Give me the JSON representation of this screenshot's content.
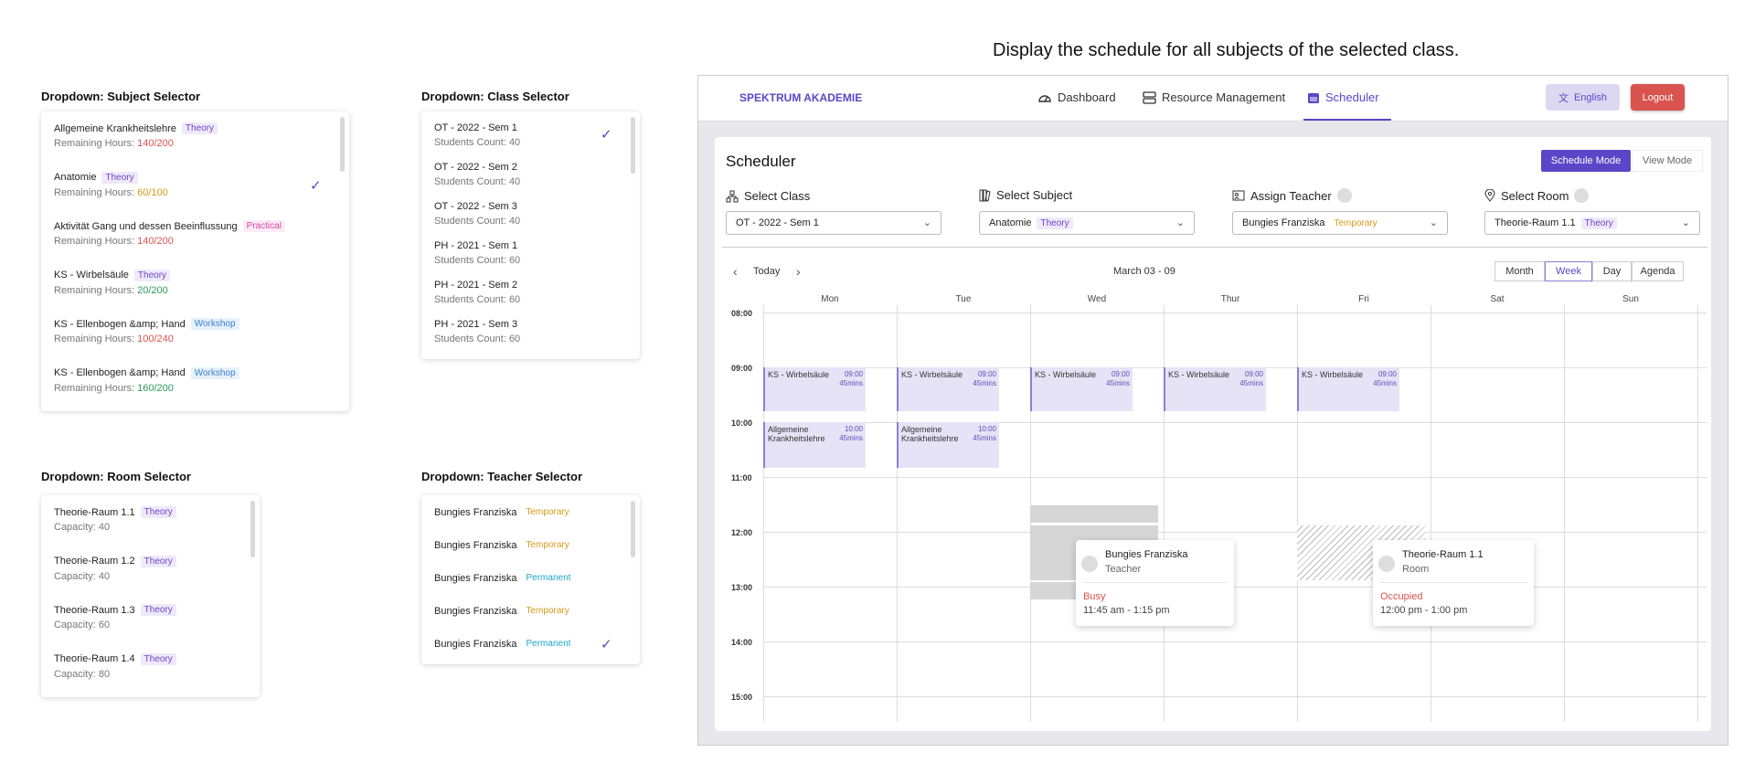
{
  "heading": "Display the schedule for all subjects of the selected class.",
  "subject_dropdown": {
    "title": "Dropdown: Subject Selector",
    "items": [
      {
        "name": "Allgemeine Krankheitslehre",
        "tag": "Theory",
        "prefix": "Remaining Hours: ",
        "hours": "140/200",
        "hours_color": "red"
      },
      {
        "name": "Anatomie",
        "tag": "Theory",
        "prefix": "Remaining Hours: ",
        "hours": "60/100",
        "hours_color": "orange"
      },
      {
        "name": "Aktivität Gang und dessen Beeinflussung",
        "tag": "Practical",
        "prefix": "Remaining Hours: ",
        "hours": "140/200",
        "hours_color": "red"
      },
      {
        "name": "KS - Wirbelsäule",
        "tag": "Theory",
        "prefix": "Remaining Hours: ",
        "hours": "20/200",
        "hours_color": "green"
      },
      {
        "name": "KS - Ellenbogen &amp; Hand",
        "tag": "Workshop",
        "prefix": "Remaining Hours: ",
        "hours": "100/240",
        "hours_color": "red"
      },
      {
        "name": "KS - Ellenbogen &amp; Hand",
        "tag": "Workshop",
        "prefix": "Remaining Hours: ",
        "hours": "160/200",
        "hours_color": "green"
      }
    ]
  },
  "class_dropdown": {
    "title": "Dropdown: Class Selector",
    "items": [
      {
        "name": "OT - 2022 - Sem 1",
        "sub": "Students Count: 40"
      },
      {
        "name": "OT - 2022 - Sem 2",
        "sub": "Students Count: 40"
      },
      {
        "name": "OT - 2022 - Sem 3",
        "sub": "Students Count: 40"
      },
      {
        "name": "PH - 2021 - Sem 1",
        "sub": "Students Count: 60"
      },
      {
        "name": "PH - 2021 - Sem 2",
        "sub": "Students Count: 60"
      },
      {
        "name": "PH - 2021 - Sem 3",
        "sub": "Students Count: 60"
      }
    ]
  },
  "room_dropdown": {
    "title": "Dropdown: Room Selector",
    "items": [
      {
        "name": "Theorie-Raum 1.1",
        "tag": "Theory",
        "sub": "Capacity: 40"
      },
      {
        "name": "Theorie-Raum 1.2",
        "tag": "Theory",
        "sub": "Capacity: 40"
      },
      {
        "name": "Theorie-Raum 1.3",
        "tag": "Theory",
        "sub": "Capacity: 60"
      },
      {
        "name": "Theorie-Raum 1.4",
        "tag": "Theory",
        "sub": "Capacity: 80"
      }
    ]
  },
  "teacher_dropdown": {
    "title": "Dropdown: Teacher Selector",
    "items": [
      {
        "name": "Bungies Franziska",
        "tag": "Temporary"
      },
      {
        "name": "Bungies Franziska",
        "tag": "Temporary"
      },
      {
        "name": "Bungies Franziska",
        "tag": "Permanent"
      },
      {
        "name": "Bungies Franziska",
        "tag": "Temporary"
      },
      {
        "name": "Bungies Franziska",
        "tag": "Permanent"
      }
    ]
  },
  "app": {
    "brand": "SPEKTRUM AKADEMIE",
    "nav": {
      "dashboard": "Dashboard",
      "resources": "Resource Management",
      "scheduler": "Scheduler"
    },
    "language": "English",
    "logout": "Logout",
    "page_title": "Scheduler",
    "mode_schedule": "Schedule Mode",
    "mode_view": "View Mode",
    "filters": {
      "class_label": "Select Class",
      "class_value": "OT - 2022 - Sem 1",
      "subject_label": "Select Subject",
      "subject_value": "Anatomie",
      "subject_tag": "Theory",
      "teacher_label": "Assign Teacher",
      "teacher_value": "Bungies Franziska",
      "teacher_tag": "Temporary",
      "room_label": "Select Room",
      "room_value": "Theorie-Raum 1.1",
      "room_tag": "Theory"
    },
    "toolbar": {
      "today": "Today",
      "range": "March 03 - 09",
      "month": "Month",
      "week": "Week",
      "day": "Day",
      "agenda": "Agenda"
    },
    "days": [
      "Mon",
      "Tue",
      "Wed",
      "Thur",
      "Fri",
      "Sat",
      "Sun"
    ],
    "times": [
      "08:00",
      "09:00",
      "10:00",
      "11:00",
      "12:00",
      "13:00",
      "14:00",
      "15:00"
    ],
    "events": {
      "ks": {
        "title": "KS - Wirbelsäule",
        "time": "09:00",
        "dur": "45mins"
      },
      "allg": {
        "title": "Allgemeine Krankheitslehre",
        "time": "10:00",
        "dur": "45mins"
      }
    },
    "teacher_tip": {
      "name": "Bungies Franziska",
      "role": "Teacher",
      "status": "Busy",
      "time": "11:45 am - 1:15 pm"
    },
    "room_tip": {
      "name": "Theorie-Raum 1.1",
      "role": "Room",
      "status": "Occupied",
      "time": "12:00 pm - 1:00 pm"
    }
  },
  "colors": {
    "accent": "#5a47c7",
    "logout": "#d9534f",
    "busy": "#d9534f"
  }
}
